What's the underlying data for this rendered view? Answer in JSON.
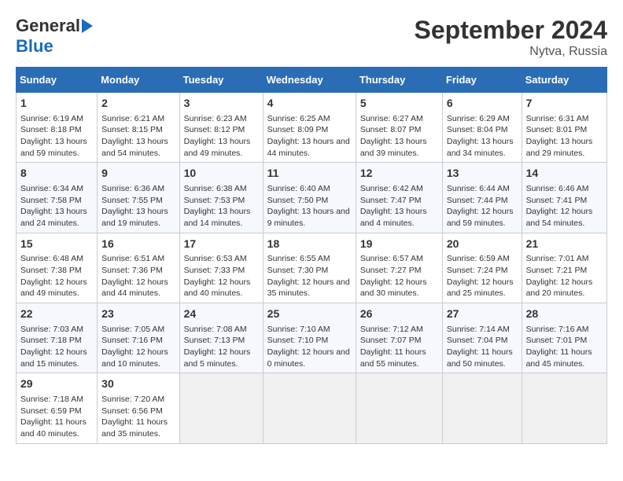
{
  "logo": {
    "general": "General",
    "blue": "Blue",
    "arrow": "▶"
  },
  "title": "September 2024",
  "subtitle": "Nytva, Russia",
  "days_of_week": [
    "Sunday",
    "Monday",
    "Tuesday",
    "Wednesday",
    "Thursday",
    "Friday",
    "Saturday"
  ],
  "weeks": [
    [
      {
        "day": "1",
        "sunrise": "6:19 AM",
        "sunset": "8:18 PM",
        "daylight": "13 hours and 59 minutes."
      },
      {
        "day": "2",
        "sunrise": "6:21 AM",
        "sunset": "8:15 PM",
        "daylight": "13 hours and 54 minutes."
      },
      {
        "day": "3",
        "sunrise": "6:23 AM",
        "sunset": "8:12 PM",
        "daylight": "13 hours and 49 minutes."
      },
      {
        "day": "4",
        "sunrise": "6:25 AM",
        "sunset": "8:09 PM",
        "daylight": "13 hours and 44 minutes."
      },
      {
        "day": "5",
        "sunrise": "6:27 AM",
        "sunset": "8:07 PM",
        "daylight": "13 hours and 39 minutes."
      },
      {
        "day": "6",
        "sunrise": "6:29 AM",
        "sunset": "8:04 PM",
        "daylight": "13 hours and 34 minutes."
      },
      {
        "day": "7",
        "sunrise": "6:31 AM",
        "sunset": "8:01 PM",
        "daylight": "13 hours and 29 minutes."
      }
    ],
    [
      {
        "day": "8",
        "sunrise": "6:34 AM",
        "sunset": "7:58 PM",
        "daylight": "13 hours and 24 minutes."
      },
      {
        "day": "9",
        "sunrise": "6:36 AM",
        "sunset": "7:55 PM",
        "daylight": "13 hours and 19 minutes."
      },
      {
        "day": "10",
        "sunrise": "6:38 AM",
        "sunset": "7:53 PM",
        "daylight": "13 hours and 14 minutes."
      },
      {
        "day": "11",
        "sunrise": "6:40 AM",
        "sunset": "7:50 PM",
        "daylight": "13 hours and 9 minutes."
      },
      {
        "day": "12",
        "sunrise": "6:42 AM",
        "sunset": "7:47 PM",
        "daylight": "13 hours and 4 minutes."
      },
      {
        "day": "13",
        "sunrise": "6:44 AM",
        "sunset": "7:44 PM",
        "daylight": "12 hours and 59 minutes."
      },
      {
        "day": "14",
        "sunrise": "6:46 AM",
        "sunset": "7:41 PM",
        "daylight": "12 hours and 54 minutes."
      }
    ],
    [
      {
        "day": "15",
        "sunrise": "6:48 AM",
        "sunset": "7:38 PM",
        "daylight": "12 hours and 49 minutes."
      },
      {
        "day": "16",
        "sunrise": "6:51 AM",
        "sunset": "7:36 PM",
        "daylight": "12 hours and 44 minutes."
      },
      {
        "day": "17",
        "sunrise": "6:53 AM",
        "sunset": "7:33 PM",
        "daylight": "12 hours and 40 minutes."
      },
      {
        "day": "18",
        "sunrise": "6:55 AM",
        "sunset": "7:30 PM",
        "daylight": "12 hours and 35 minutes."
      },
      {
        "day": "19",
        "sunrise": "6:57 AM",
        "sunset": "7:27 PM",
        "daylight": "12 hours and 30 minutes."
      },
      {
        "day": "20",
        "sunrise": "6:59 AM",
        "sunset": "7:24 PM",
        "daylight": "12 hours and 25 minutes."
      },
      {
        "day": "21",
        "sunrise": "7:01 AM",
        "sunset": "7:21 PM",
        "daylight": "12 hours and 20 minutes."
      }
    ],
    [
      {
        "day": "22",
        "sunrise": "7:03 AM",
        "sunset": "7:18 PM",
        "daylight": "12 hours and 15 minutes."
      },
      {
        "day": "23",
        "sunrise": "7:05 AM",
        "sunset": "7:16 PM",
        "daylight": "12 hours and 10 minutes."
      },
      {
        "day": "24",
        "sunrise": "7:08 AM",
        "sunset": "7:13 PM",
        "daylight": "12 hours and 5 minutes."
      },
      {
        "day": "25",
        "sunrise": "7:10 AM",
        "sunset": "7:10 PM",
        "daylight": "12 hours and 0 minutes."
      },
      {
        "day": "26",
        "sunrise": "7:12 AM",
        "sunset": "7:07 PM",
        "daylight": "11 hours and 55 minutes."
      },
      {
        "day": "27",
        "sunrise": "7:14 AM",
        "sunset": "7:04 PM",
        "daylight": "11 hours and 50 minutes."
      },
      {
        "day": "28",
        "sunrise": "7:16 AM",
        "sunset": "7:01 PM",
        "daylight": "11 hours and 45 minutes."
      }
    ],
    [
      {
        "day": "29",
        "sunrise": "7:18 AM",
        "sunset": "6:59 PM",
        "daylight": "11 hours and 40 minutes."
      },
      {
        "day": "30",
        "sunrise": "7:20 AM",
        "sunset": "6:56 PM",
        "daylight": "11 hours and 35 minutes."
      },
      null,
      null,
      null,
      null,
      null
    ]
  ],
  "labels": {
    "sunrise": "Sunrise:",
    "sunset": "Sunset:",
    "daylight": "Daylight:"
  }
}
